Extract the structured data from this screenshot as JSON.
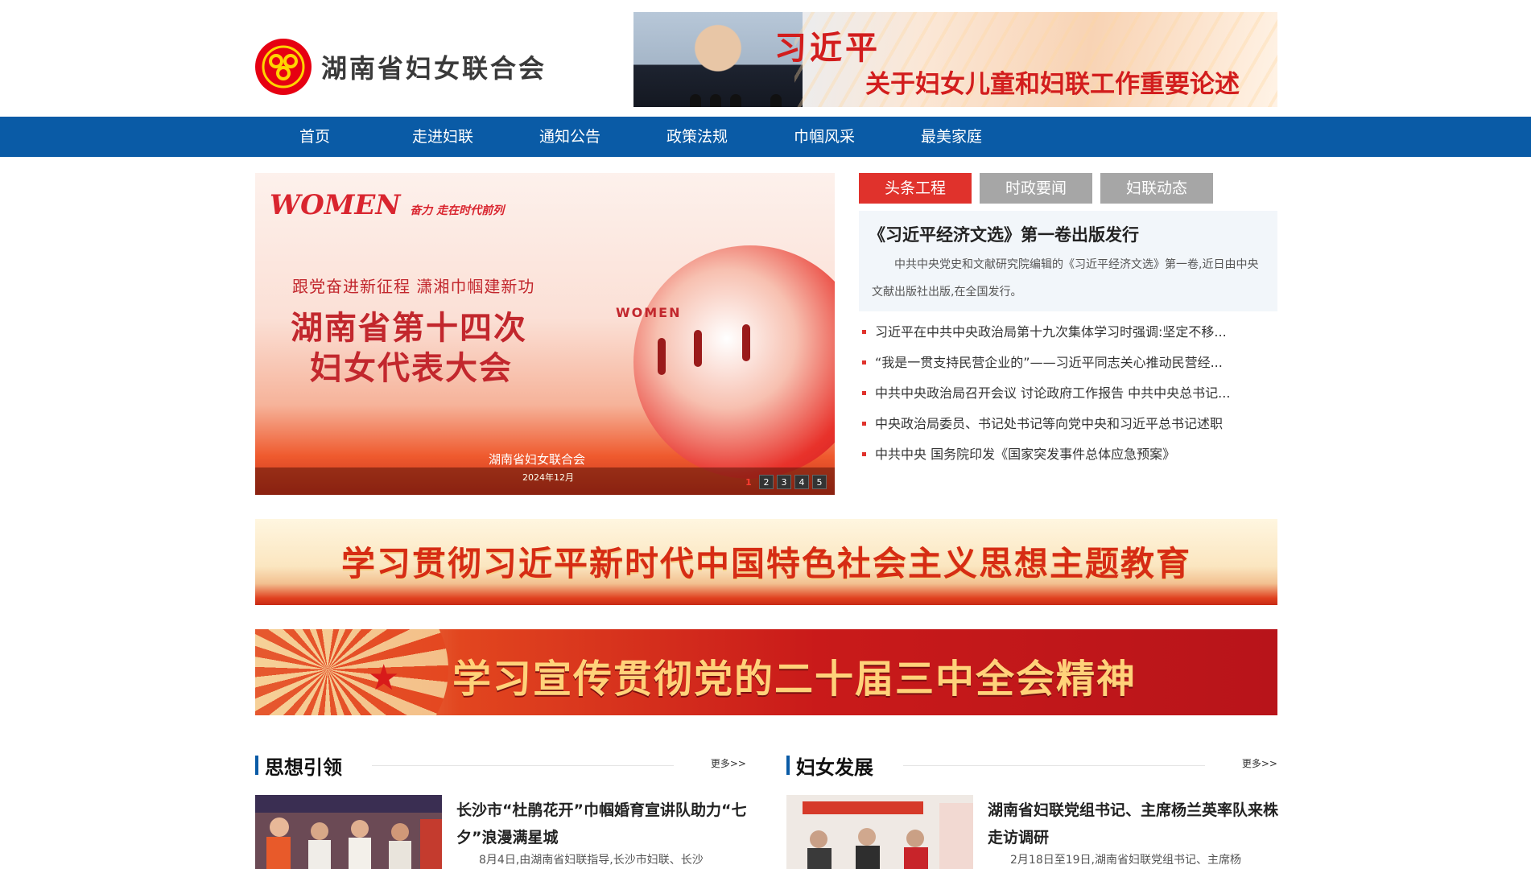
{
  "site": {
    "name": "湖南省妇女联合会",
    "top_banner": {
      "title": "习近平",
      "subtitle": "关于妇女儿童和妇联工作重要论述"
    }
  },
  "nav": {
    "items": [
      "首页",
      "走进妇联",
      "通知公告",
      "政策法规",
      "巾帼风采",
      "最美家庭"
    ]
  },
  "slider": {
    "brand": "WOMEN",
    "brand_sub": "奋力 走在时代前列",
    "subtitle": "跟党奋进新征程 潇湘巾帼建新功",
    "heading_line1": "湖南省第十四次",
    "heading_line2": "妇女代表大会",
    "vertical_word": "WOMEN",
    "org": "湖南省妇女联合会",
    "date": "2024年12月",
    "pages": [
      "1",
      "2",
      "3",
      "4",
      "5"
    ],
    "active_page": 1
  },
  "tabs": [
    "头条工程",
    "时政要闻",
    "妇联动态"
  ],
  "headline": {
    "title": "《习近平经济文选》第一卷出版发行",
    "summary": "中共中央党史和文献研究院编辑的《习近平经济文选》第一卷,近日由中央文献出版社出版,在全国发行。"
  },
  "news": [
    "习近平在中共中央政治局第十九次集体学习时强调:坚定不移...",
    "“我是一贯支持民营企业的”——习近平同志关心推动民营经...",
    "中共中央政治局召开会议 讨论政府工作报告 中共中央总书记...",
    "中央政治局委员、书记处书记等向党中央和习近平总书记述职",
    "中共中央 国务院印发《国家突发事件总体应急预案》"
  ],
  "banners": {
    "banner1": "学习贯彻习近平新时代中国特色社会主义思想主题教育",
    "banner2": "学习宣传贯彻党的二十届三中全会精神"
  },
  "sections": {
    "left": {
      "title": "思想引领",
      "more": "更多>>",
      "card_title": "长沙市“杜鹃花开”巾帼婚育宣讲队助力“七夕”浪漫满星城",
      "card_summary": "8月4日,由湖南省妇联指导,长沙市妇联、长沙"
    },
    "right": {
      "title": "妇女发展",
      "more": "更多>>",
      "card_title": "湖南省妇联党组书记、主席杨兰英率队来株走访调研",
      "card_summary": "2月18日至19日,湖南省妇联党组书记、主席杨"
    }
  },
  "colors": {
    "nav_bg": "#0a5ba6",
    "tab_active": "#e0322c",
    "tab_inactive": "#a6a6a6",
    "accent_red": "#e60012"
  }
}
